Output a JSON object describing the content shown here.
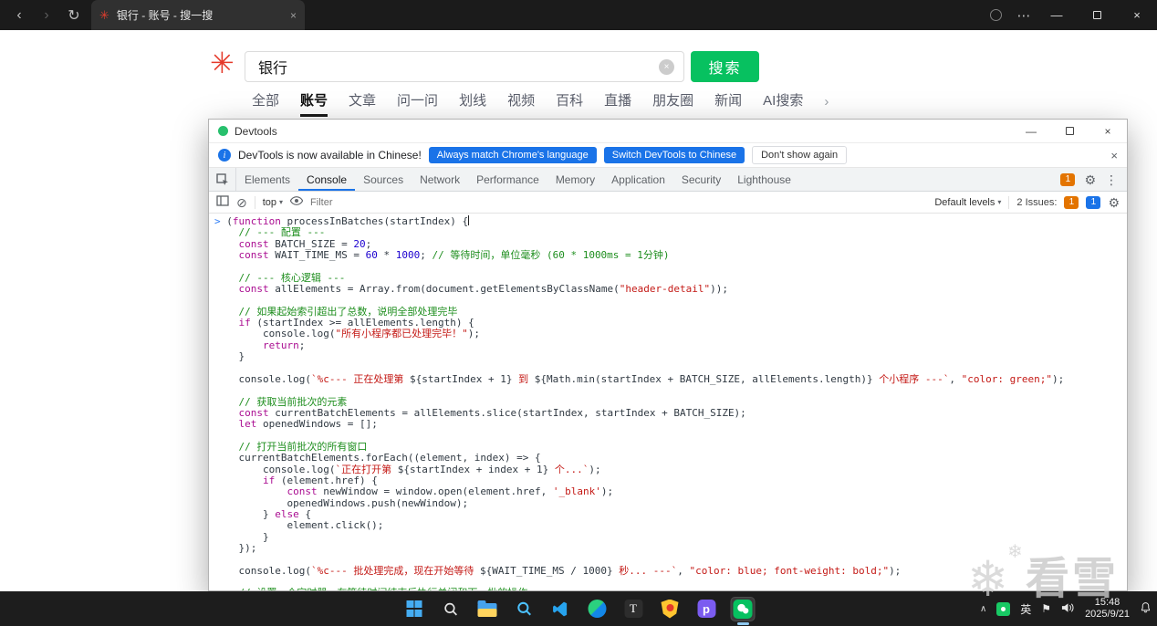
{
  "icons": {
    "back": "‹",
    "forward": "›",
    "refresh": "↻",
    "overflow_menu": "⋯",
    "window_minimize": "—",
    "window_close": "×",
    "tab_close": "×",
    "clear_input": "×",
    "logo_flower": "✳",
    "chevron_right": "›",
    "info": "i",
    "gear": "⚙",
    "kebab": "⋮",
    "block": "⊘",
    "dropdown_caret": "▾",
    "tray_chevron": "∧",
    "flag": "⚑",
    "snowflake": "❄",
    "devtools_minimize": "—",
    "devtools_close": "×",
    "infobar_close": "×"
  },
  "browser_chrome": {
    "tab_title": "银行 - 账号 - 搜一搜"
  },
  "search_page": {
    "query": "银行",
    "search_button_label": "搜索",
    "active_tab": "账号",
    "nav_tabs": [
      {
        "label": "全部"
      },
      {
        "label": "账号"
      },
      {
        "label": "文章"
      },
      {
        "label": "问一问"
      },
      {
        "label": "划线"
      },
      {
        "label": "视频"
      },
      {
        "label": "百科"
      },
      {
        "label": "直播"
      },
      {
        "label": "朋友圈"
      },
      {
        "label": "新闻"
      },
      {
        "label": "AI搜索"
      }
    ]
  },
  "devtools": {
    "window_title": "Devtools",
    "infobar": {
      "message": "DevTools is now available in Chinese!",
      "primary_button": "Always match Chrome's language",
      "secondary_button": "Switch DevTools to Chinese",
      "dismiss_button": "Don't show again"
    },
    "tabs": [
      "Elements",
      "Console",
      "Sources",
      "Network",
      "Performance",
      "Memory",
      "Application",
      "Security",
      "Lighthouse"
    ],
    "active_tab": "Console",
    "tab_strip_issue_count": "1",
    "toolbar": {
      "context": "top",
      "filter_placeholder": "Filter",
      "levels": "Default levels",
      "issues_label": "2 Issues:",
      "issue_badge_orange": "1",
      "issue_badge_blue": "1"
    },
    "console_lines": [
      [
        [
          "p",
          "> "
        ],
        [
          "d",
          "("
        ],
        [
          "k",
          "function"
        ],
        [
          "d",
          " processInBatches(startIndex) {"
        ],
        [
          "cursor",
          ""
        ]
      ],
      [
        [
          "c",
          "    // --- 配置 ---"
        ]
      ],
      [
        [
          "d",
          "    "
        ],
        [
          "k",
          "const"
        ],
        [
          "d",
          " BATCH_SIZE = "
        ],
        [
          "n",
          "20"
        ],
        [
          "d",
          ";"
        ]
      ],
      [
        [
          "d",
          "    "
        ],
        [
          "k",
          "const"
        ],
        [
          "d",
          " WAIT_TIME_MS = "
        ],
        [
          "n",
          "60"
        ],
        [
          "d",
          " * "
        ],
        [
          "n",
          "1000"
        ],
        [
          "d",
          "; "
        ],
        [
          "c",
          "// 等待时间，单位毫秒 (60 * 1000ms = 1分钟)"
        ]
      ],
      [],
      [
        [
          "c",
          "    // --- 核心逻辑 ---"
        ]
      ],
      [
        [
          "d",
          "    "
        ],
        [
          "k",
          "const"
        ],
        [
          "d",
          " allElements = Array.from(document.getElementsByClassName("
        ],
        [
          "s",
          "\"header-detail\""
        ],
        [
          "d",
          "));"
        ]
      ],
      [],
      [
        [
          "c",
          "    // 如果起始索引超出了总数，说明全部处理完毕"
        ]
      ],
      [
        [
          "d",
          "    "
        ],
        [
          "k",
          "if"
        ],
        [
          "d",
          " (startIndex >= allElements.length) {"
        ]
      ],
      [
        [
          "d",
          "        console.log("
        ],
        [
          "s",
          "\"所有小程序都已处理完毕！\""
        ],
        [
          "d",
          ");"
        ]
      ],
      [
        [
          "d",
          "        "
        ],
        [
          "k",
          "return"
        ],
        [
          "d",
          ";"
        ]
      ],
      [
        [
          "d",
          "    }"
        ]
      ],
      [],
      [
        [
          "d",
          "    console.log("
        ],
        [
          "s",
          "`%c--- 正在处理第 "
        ],
        [
          "d",
          "${startIndex + 1}"
        ],
        [
          "s",
          " 到 "
        ],
        [
          "d",
          "${Math.min(startIndex + BATCH_SIZE, allElements.length)}"
        ],
        [
          "s",
          " 个小程序 ---`"
        ],
        [
          "d",
          ", "
        ],
        [
          "s",
          "\"color: green;\""
        ],
        [
          "d",
          ");"
        ]
      ],
      [],
      [
        [
          "c",
          "    // 获取当前批次的元素"
        ]
      ],
      [
        [
          "d",
          "    "
        ],
        [
          "k",
          "const"
        ],
        [
          "d",
          " currentBatchElements = allElements.slice(startIndex, startIndex + BATCH_SIZE);"
        ]
      ],
      [
        [
          "d",
          "    "
        ],
        [
          "k",
          "let"
        ],
        [
          "d",
          " openedWindows = [];"
        ]
      ],
      [],
      [
        [
          "c",
          "    // 打开当前批次的所有窗口"
        ]
      ],
      [
        [
          "d",
          "    currentBatchElements.forEach((element, index) => {"
        ]
      ],
      [
        [
          "d",
          "        console.log("
        ],
        [
          "s",
          "`正在打开第 "
        ],
        [
          "d",
          "${startIndex + index + 1}"
        ],
        [
          "s",
          " 个...`"
        ],
        [
          "d",
          ");"
        ]
      ],
      [
        [
          "d",
          "        "
        ],
        [
          "k",
          "if"
        ],
        [
          "d",
          " (element.href) {"
        ]
      ],
      [
        [
          "d",
          "            "
        ],
        [
          "k",
          "const"
        ],
        [
          "d",
          " newWindow = window.open(element.href, "
        ],
        [
          "s",
          "'_blank'"
        ],
        [
          "d",
          ");"
        ]
      ],
      [
        [
          "d",
          "            openedWindows.push(newWindow);"
        ]
      ],
      [
        [
          "d",
          "        } "
        ],
        [
          "k",
          "else"
        ],
        [
          "d",
          " {"
        ]
      ],
      [
        [
          "d",
          "            element.click();"
        ]
      ],
      [
        [
          "d",
          "        }"
        ]
      ],
      [
        [
          "d",
          "    });"
        ]
      ],
      [],
      [
        [
          "d",
          "    console.log("
        ],
        [
          "s",
          "`%c--- 批处理完成，现在开始等待 "
        ],
        [
          "d",
          "${WAIT_TIME_MS / 1000}"
        ],
        [
          "s",
          " 秒... ---`"
        ],
        [
          "d",
          ", "
        ],
        [
          "s",
          "\"color: blue; font-weight: bold;\""
        ],
        [
          "d",
          ");"
        ]
      ],
      [],
      [
        [
          "c",
          "    // 设置一个定时器，在等待时间结束后执行关闭和下一批的操作"
        ]
      ]
    ]
  },
  "taskbar": {
    "language_indicator": "英",
    "time": "15:48",
    "date": "2025/9/21",
    "app_icons": [
      "start",
      "search",
      "file-explorer",
      "blue-search-app",
      "vscode",
      "dev-app",
      "typora",
      "security-shield-app",
      "purple-p-app",
      "wechat"
    ]
  },
  "watermark": {
    "text": "看雪"
  },
  "colors": {
    "accent_green": "#07c160",
    "devtools_blue": "#1a73e8",
    "badge_orange": "#e37400",
    "badge_blue": "#1a73e8"
  }
}
